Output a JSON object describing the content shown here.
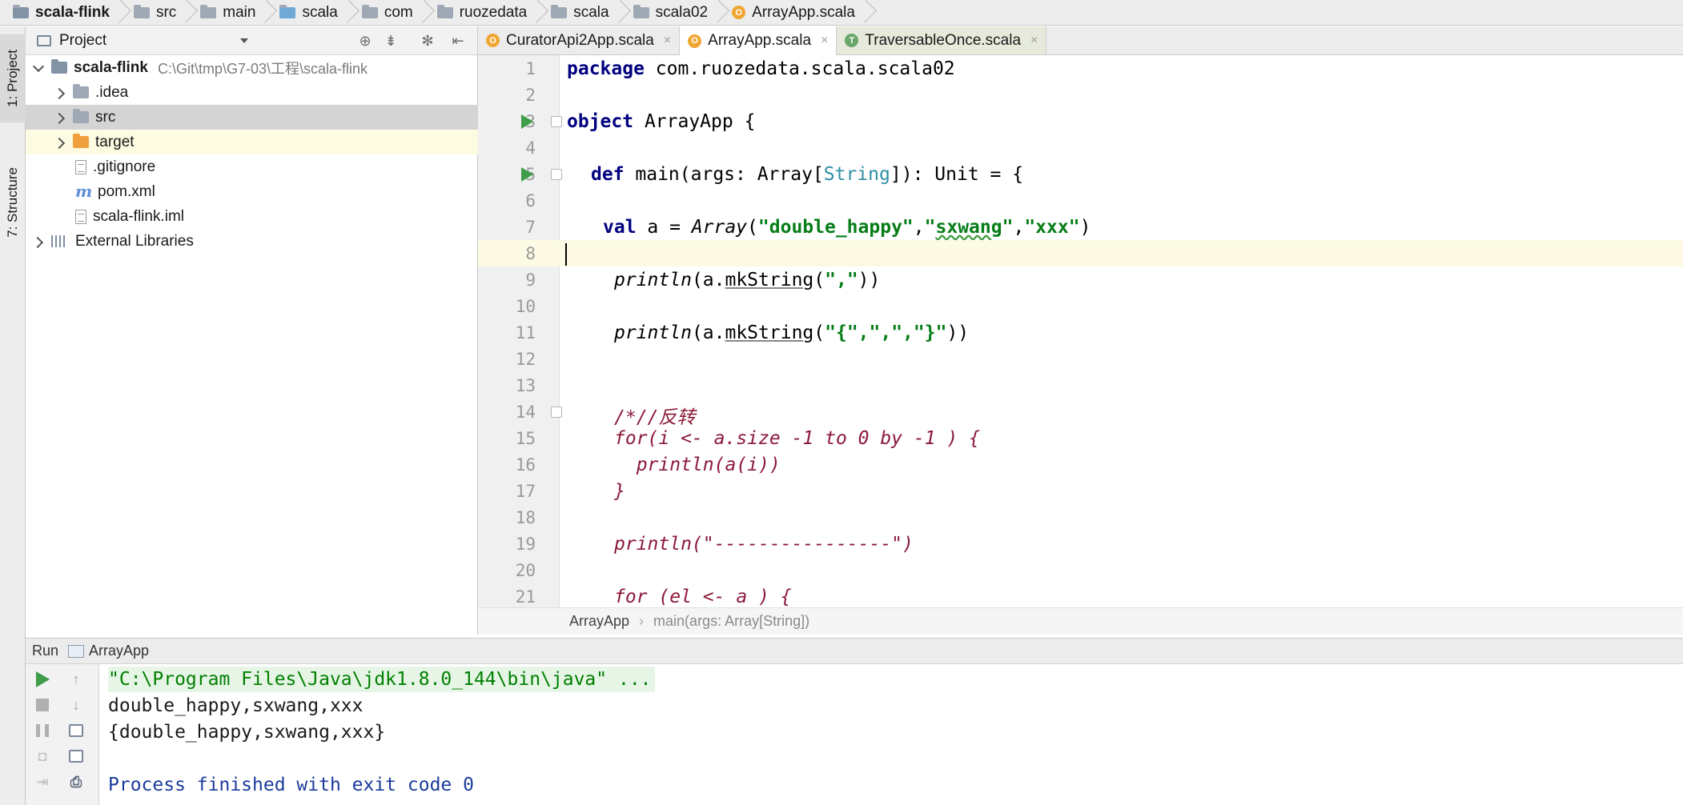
{
  "breadcrumb": {
    "items": [
      "scala-flink",
      "src",
      "main",
      "scala",
      "com",
      "ruozedata",
      "scala",
      "scala02",
      "ArrayApp.scala"
    ]
  },
  "left_strip": {
    "project_tab": "1: Project",
    "structure_tab": "7: Structure"
  },
  "project_panel": {
    "title": "Project",
    "tree": {
      "root_name": "scala-flink",
      "root_path": "C:\\Git\\tmp\\G7-03\\工程\\scala-flink",
      "idea": ".idea",
      "src": "src",
      "target": "target",
      "gitignore": ".gitignore",
      "pom": "pom.xml",
      "iml": "scala-flink.iml",
      "external": "External Libraries"
    }
  },
  "editor_tabs": {
    "tab1": "CuratorApi2App.scala",
    "tab2": "ArrayApp.scala",
    "tab3": "TraversableOnce.scala",
    "close": "×"
  },
  "editor": {
    "line_numbers": [
      "1",
      "2",
      "3",
      "4",
      "5",
      "6",
      "7",
      "8",
      "9",
      "10",
      "11",
      "12",
      "13",
      "14",
      "15",
      "16",
      "17",
      "18",
      "19",
      "20",
      "21"
    ],
    "code": {
      "l1_kw": "package",
      "l1_rest": " com.ruozedata.scala.scala02",
      "l3_kw": "object",
      "l3_rest": " ArrayApp {",
      "l5_kw": "def",
      "l5_a": " main(args: Array[",
      "l5_type": "String",
      "l5_b": "]): Unit = {",
      "l7_kw": "val",
      "l7_a": " a = ",
      "l7_arr": "Array",
      "l7_b": "(",
      "l7_s1": "\"double_happy\"",
      "l7_c": ",",
      "l7_s2a": "\"",
      "l7_s2b": "sxwang",
      "l7_s2c": "\"",
      "l7_d": ",",
      "l7_s3": "\"xxx\"",
      "l7_e": ")",
      "l9_fn": "println",
      "l9_a": "(a.",
      "l9_mk": "mkString",
      "l9_b": "(",
      "l9_s": "\",\"",
      "l9_c": "))",
      "l11_fn": "println",
      "l11_a": "(a.",
      "l11_mk": "mkString",
      "l11_b": "(",
      "l11_s": "\"{\",\",\",\"}\"",
      "l11_c": "))",
      "l14": "/*//反转",
      "l15": "for(i <- a.size -1 to 0 by -1 ) {",
      "l16": "  println(a(i))",
      "l17": "}",
      "l19": "println(\"----------------\")",
      "l21": "for (el <- a ) {"
    }
  },
  "editor_breadcrumb": {
    "item1": "ArrayApp",
    "sep": "›",
    "item2": "main(args: Array[String])"
  },
  "run_panel": {
    "label": "Run",
    "config": "ArrayApp",
    "console": {
      "cmd": "\"C:\\Program Files\\Java\\jdk1.8.0_144\\bin\\java\" ...",
      "out1": "double_happy,sxwang,xxx",
      "out2": "{double_happy,sxwang,xxx}",
      "finish": "Process finished with exit code 0"
    }
  },
  "colors": {
    "keyword": "#000080",
    "string": "#067d17",
    "comment": "#8b1a3a",
    "type": "#2f8fa5",
    "run_green": "#3e9d4a",
    "current_line": "#fcfae2"
  }
}
